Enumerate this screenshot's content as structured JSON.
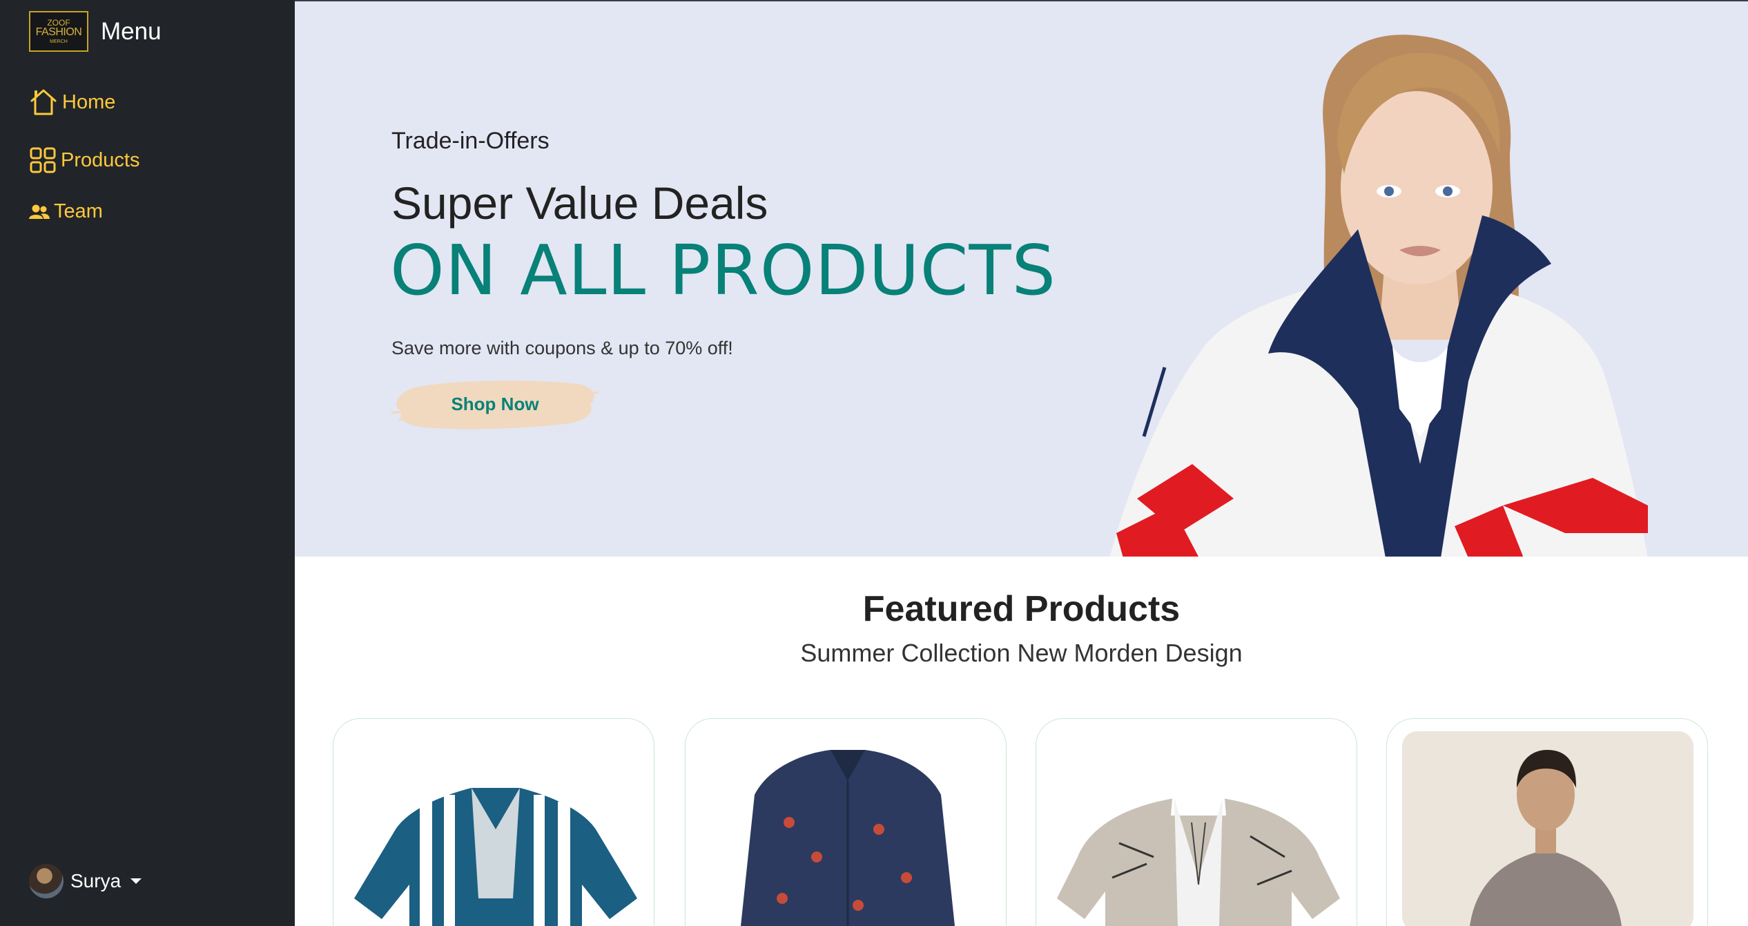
{
  "sidebar": {
    "logo": {
      "line1": "ZOOF",
      "line2": "FASHION",
      "line3": "MERCH"
    },
    "title": "Menu",
    "items": [
      {
        "label": "Home",
        "icon": "home-icon"
      },
      {
        "label": "Products",
        "icon": "grid-icon"
      },
      {
        "label": "Team",
        "icon": "people-icon"
      }
    ],
    "user": {
      "name": "Surya"
    }
  },
  "hero": {
    "kicker": "Trade-in-Offers",
    "title": "Super Value Deals",
    "headline": "ON ALL PRODUCTS",
    "subtitle": "Save more with coupons & up to 70% off!",
    "button_label": "Shop Now"
  },
  "featured": {
    "title": "Featured Products",
    "subtitle": "Summer Collection New Morden Design"
  },
  "colors": {
    "sidebar_bg": "#212529",
    "accent_yellow": "#ffc93c",
    "brand_teal": "#088178",
    "hero_bg": "#e3e6f3",
    "button_brush": "#f1d9bf"
  }
}
